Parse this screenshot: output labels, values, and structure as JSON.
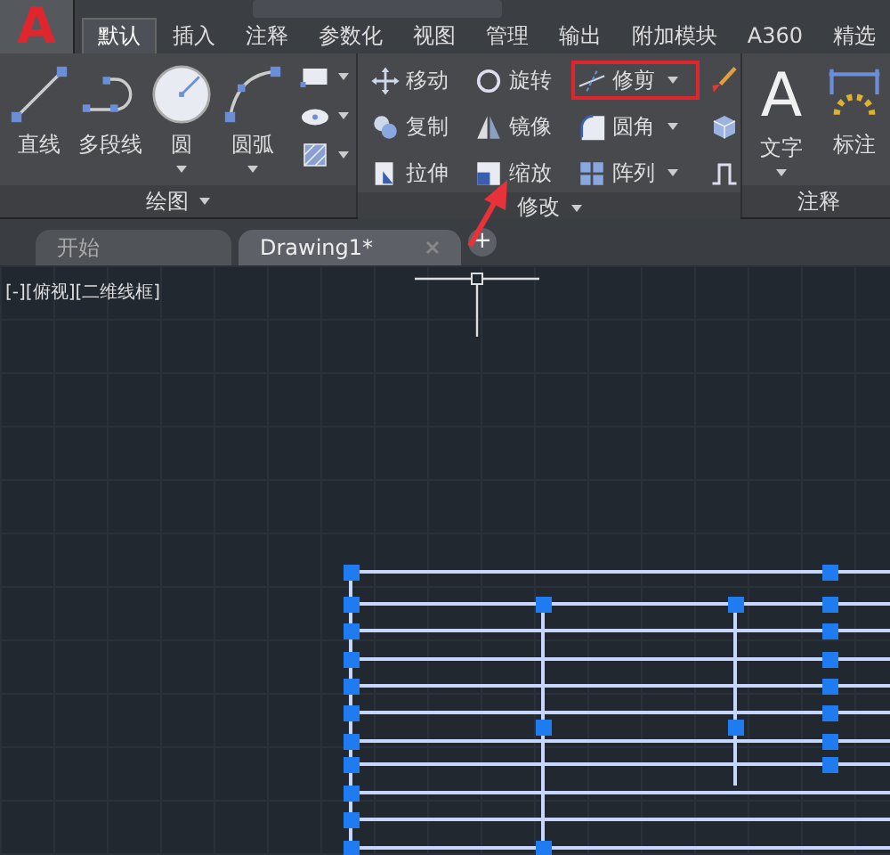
{
  "app_button": {
    "label": "A"
  },
  "ribbon_tabs": [
    {
      "label": "默认",
      "selected": true
    },
    {
      "label": "插入",
      "selected": false
    },
    {
      "label": "注释",
      "selected": false
    },
    {
      "label": "参数化",
      "selected": false
    },
    {
      "label": "视图",
      "selected": false
    },
    {
      "label": "管理",
      "selected": false
    },
    {
      "label": "输出",
      "selected": false
    },
    {
      "label": "附加模块",
      "selected": false
    },
    {
      "label": "A360",
      "selected": false
    },
    {
      "label": "精选",
      "selected": false
    }
  ],
  "draw_panel": {
    "title": "绘图",
    "tools": [
      {
        "label": "直线",
        "dropdown": false
      },
      {
        "label": "多段线",
        "dropdown": false
      },
      {
        "label": "圆",
        "dropdown": true
      },
      {
        "label": "圆弧",
        "dropdown": true
      }
    ]
  },
  "modify_panel": {
    "title": "修改",
    "rows": [
      [
        {
          "label": "移动",
          "dropdown": false,
          "highlighted": false
        },
        {
          "label": "旋转",
          "dropdown": false,
          "highlighted": false
        },
        {
          "label": "修剪",
          "dropdown": true,
          "highlighted": true
        }
      ],
      [
        {
          "label": "复制",
          "dropdown": false,
          "highlighted": false
        },
        {
          "label": "镜像",
          "dropdown": false,
          "highlighted": false
        },
        {
          "label": "圆角",
          "dropdown": true,
          "highlighted": false
        }
      ],
      [
        {
          "label": "拉伸",
          "dropdown": false,
          "highlighted": false
        },
        {
          "label": "缩放",
          "dropdown": false,
          "highlighted": false
        },
        {
          "label": "阵列",
          "dropdown": true,
          "highlighted": false
        }
      ]
    ]
  },
  "annotation_panel": {
    "title": "注释",
    "tools": [
      {
        "label": "文字",
        "glyph": "A",
        "dropdown": true
      },
      {
        "label": "标注",
        "dropdown": false
      }
    ]
  },
  "file_tabs": [
    {
      "label": "开始",
      "selected": false,
      "closable": false
    },
    {
      "label": "Drawing1*",
      "selected": true,
      "closable": true
    }
  ],
  "new_tab": {
    "label": "+"
  },
  "viewport": {
    "label": "[-][俯视][二维线框]"
  }
}
